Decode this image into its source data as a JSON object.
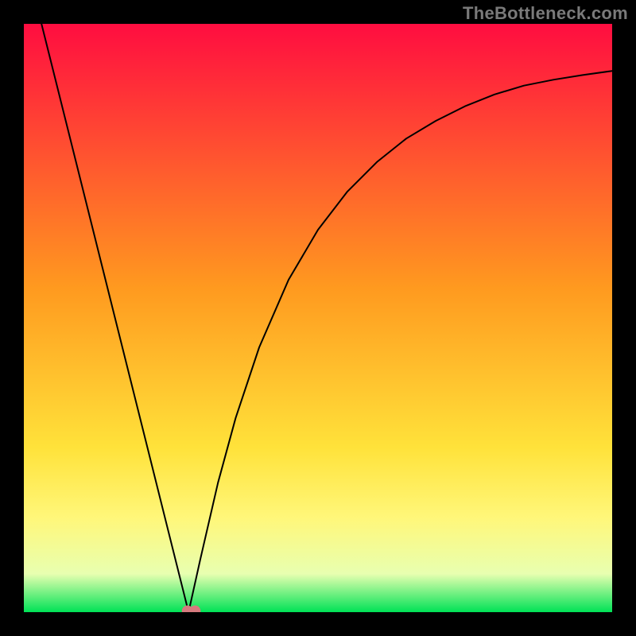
{
  "watermark": "TheBottleneck.com",
  "chart_data": {
    "type": "line",
    "title": "",
    "xlabel": "",
    "ylabel": "",
    "xlim": [
      0,
      1
    ],
    "ylim": [
      0,
      1
    ],
    "grid": false,
    "legend": false,
    "background_gradient": {
      "stops": [
        {
          "offset": 0.0,
          "color": "#ff0d40"
        },
        {
          "offset": 0.45,
          "color": "#ff9a1f"
        },
        {
          "offset": 0.72,
          "color": "#ffe23a"
        },
        {
          "offset": 0.84,
          "color": "#fff77a"
        },
        {
          "offset": 0.935,
          "color": "#e8ffb0"
        },
        {
          "offset": 1.0,
          "color": "#00e256"
        }
      ]
    },
    "series": [
      {
        "name": "bottleneck-curve",
        "color": "#000000",
        "stroke_width": 2,
        "x": [
          0.03,
          0.06,
          0.09,
          0.12,
          0.15,
          0.18,
          0.21,
          0.24,
          0.27,
          0.28,
          0.3,
          0.33,
          0.36,
          0.4,
          0.45,
          0.5,
          0.55,
          0.6,
          0.65,
          0.7,
          0.75,
          0.8,
          0.85,
          0.9,
          0.95,
          1.0
        ],
        "y": [
          1.0,
          0.88,
          0.76,
          0.64,
          0.52,
          0.4,
          0.28,
          0.16,
          0.04,
          0.0,
          0.09,
          0.22,
          0.33,
          0.45,
          0.565,
          0.65,
          0.715,
          0.765,
          0.805,
          0.835,
          0.86,
          0.88,
          0.895,
          0.905,
          0.913,
          0.92
        ]
      }
    ],
    "markers": [
      {
        "name": "optimum-point",
        "x": 0.278,
        "y": 0.002,
        "color": "#d67a7e",
        "r": 7
      },
      {
        "name": "optimum-point-2",
        "x": 0.291,
        "y": 0.002,
        "color": "#d67a7e",
        "r": 7
      }
    ]
  }
}
